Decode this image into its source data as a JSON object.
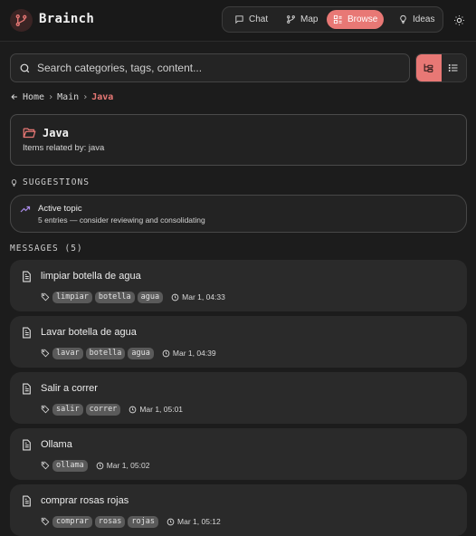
{
  "app": {
    "brand": "Brainch"
  },
  "nav": {
    "chat": "Chat",
    "map": "Map",
    "browse": "Browse",
    "ideas": "Ideas"
  },
  "search": {
    "placeholder": "Search categories, tags, content..."
  },
  "breadcrumb": {
    "home": "Home",
    "main": "Main",
    "current": "Java"
  },
  "category": {
    "title": "Java",
    "description": "Items related by: java"
  },
  "suggestions": {
    "header": "SUGGESTIONS",
    "items": [
      {
        "title": "Active topic",
        "detail": "5 entries — consider reviewing and consolidating"
      }
    ]
  },
  "messages": {
    "header": "MESSAGES (5)",
    "items": [
      {
        "title": "limpiar botella de agua",
        "tags": [
          "limpiar",
          "botella",
          "agua"
        ],
        "time": "Mar 1, 04:33"
      },
      {
        "title": "Lavar botella de agua",
        "tags": [
          "lavar",
          "botella",
          "agua"
        ],
        "time": "Mar 1, 04:39"
      },
      {
        "title": "Salir a correr",
        "tags": [
          "salir",
          "correr"
        ],
        "time": "Mar 1, 05:01"
      },
      {
        "title": "Ollama",
        "tags": [
          "ollama"
        ],
        "time": "Mar 1, 05:02"
      },
      {
        "title": "comprar rosas rojas",
        "tags": [
          "comprar",
          "rosas",
          "rojas"
        ],
        "time": "Mar 1, 05:12"
      }
    ]
  },
  "colors": {
    "accent": "#e87875",
    "background": "#1c1c1c",
    "card": "#2a2a2a"
  }
}
